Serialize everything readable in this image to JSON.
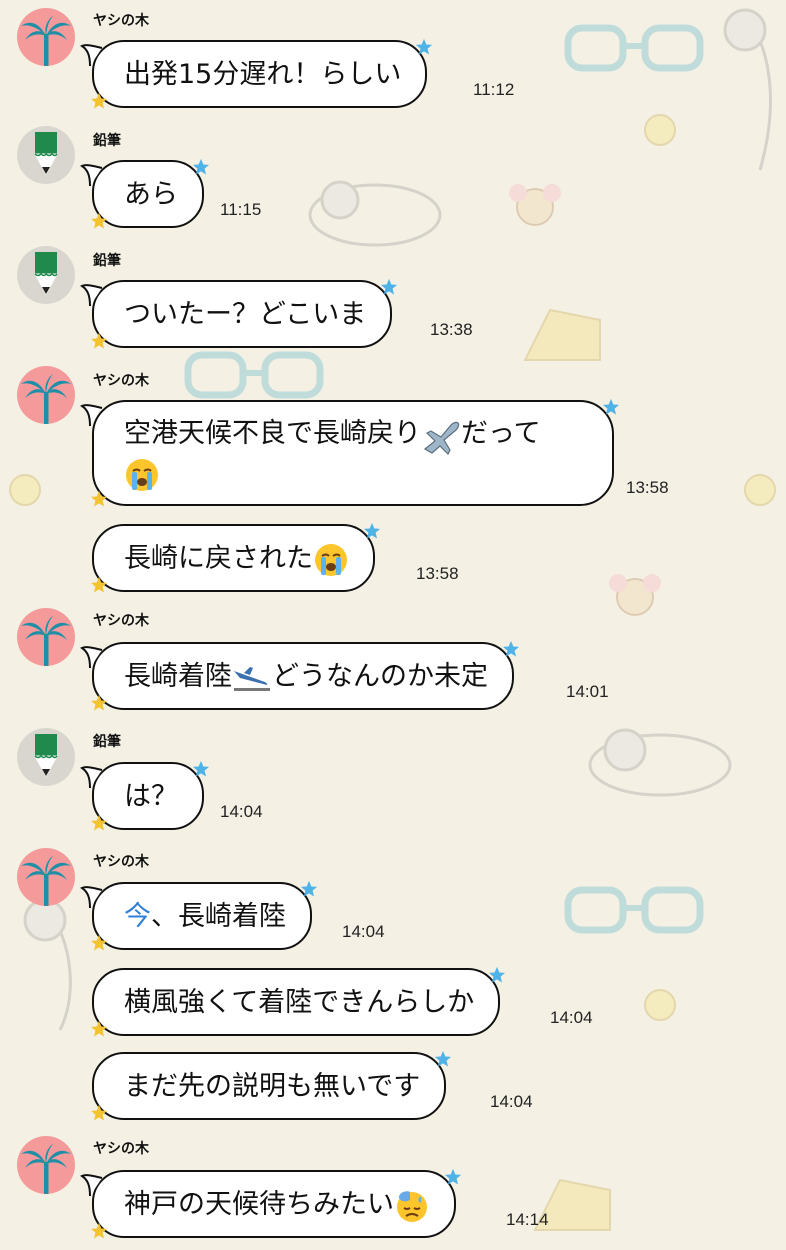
{
  "senders": {
    "palm": "ヤシの木",
    "pencil": "鉛筆"
  },
  "messages": [
    {
      "sender": "palm",
      "text": "出発15分遅れ！らしい",
      "time": "11:12"
    },
    {
      "sender": "pencil",
      "text": "あら",
      "time": "11:15"
    },
    {
      "sender": "pencil",
      "text": "ついたー？どこいま",
      "time": "13:38"
    },
    {
      "sender": "palm",
      "text": "空港天候不良で長崎戻り",
      "text_b": "だって",
      "time": "13:58"
    },
    {
      "sender": "palm",
      "text": "長崎に戻された",
      "time": "13:58"
    },
    {
      "sender": "palm",
      "text": "長崎着陸",
      "text_b": "どうなんのか未定",
      "time": "14:01"
    },
    {
      "sender": "pencil",
      "text": "は？",
      "time": "14:04"
    },
    {
      "sender": "palm",
      "link": "今",
      "text": "、長崎着陸",
      "time": "14:04"
    },
    {
      "sender": "palm",
      "text": "横風強くて着陸できんらしか",
      "time": "14:04"
    },
    {
      "sender": "palm",
      "text": "まだ先の説明も無いです",
      "time": "14:04"
    },
    {
      "sender": "palm",
      "text": "神戸の天候待ちみたい",
      "time": "14:14"
    }
  ],
  "icons": {
    "palm_avatar": "palm-tree-icon",
    "pencil_avatar": "pencil-icon",
    "airplane": "airplane-emoji",
    "crying": "loudly-crying-face-emoji",
    "landing": "airplane-arrival-emoji",
    "sweat": "downcast-face-with-sweat-emoji"
  },
  "colors": {
    "background": "#f4f1e4",
    "palm_avatar_bg": "#f59a9b",
    "palm_leaf": "#1f8fa8",
    "pencil_green": "#1f8a4c",
    "link": "#2f7fd6"
  }
}
